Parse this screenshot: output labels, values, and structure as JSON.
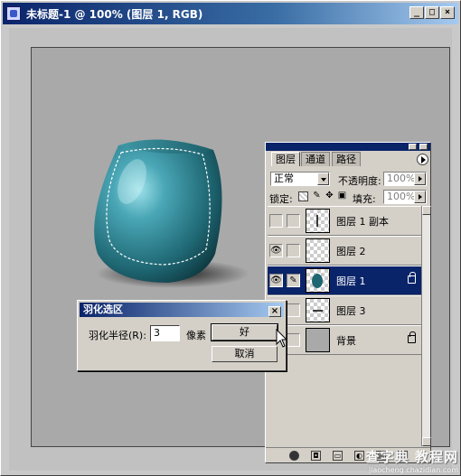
{
  "window": {
    "title": "未标题-1 @ 100% (图层 1, RGB)",
    "minimize_label": "_",
    "maximize_label": "□",
    "close_label": "×"
  },
  "layers_panel": {
    "tabs": [
      {
        "label": "图层"
      },
      {
        "label": "通道"
      },
      {
        "label": "路径"
      }
    ],
    "blend_mode": "正常",
    "opacity_label": "不透明度:",
    "opacity_value": "100%",
    "lock_label": "锁定:",
    "fill_label": "填充:",
    "fill_value": "100%",
    "layers": [
      {
        "name": "图层 1 副本",
        "visible": false,
        "selected": false
      },
      {
        "name": "图层 2",
        "visible": true,
        "selected": false
      },
      {
        "name": "图层 1",
        "visible": true,
        "selected": true
      },
      {
        "name": "图层 3",
        "visible": false,
        "selected": false
      },
      {
        "name": "背景",
        "visible": false,
        "selected": false
      }
    ]
  },
  "feather_dialog": {
    "title": "羽化选区",
    "radius_label": "羽化半径(R):",
    "radius_value": "3",
    "unit": "像素",
    "ok_label": "好",
    "cancel_label": "取消"
  },
  "watermark": {
    "line1": "查字典 教程网",
    "line2": "jiaocheng.chazidian.com"
  },
  "colors": {
    "title_bar": "#0a246a",
    "vase": "#2b7f8c",
    "selection": "#0a246a"
  }
}
